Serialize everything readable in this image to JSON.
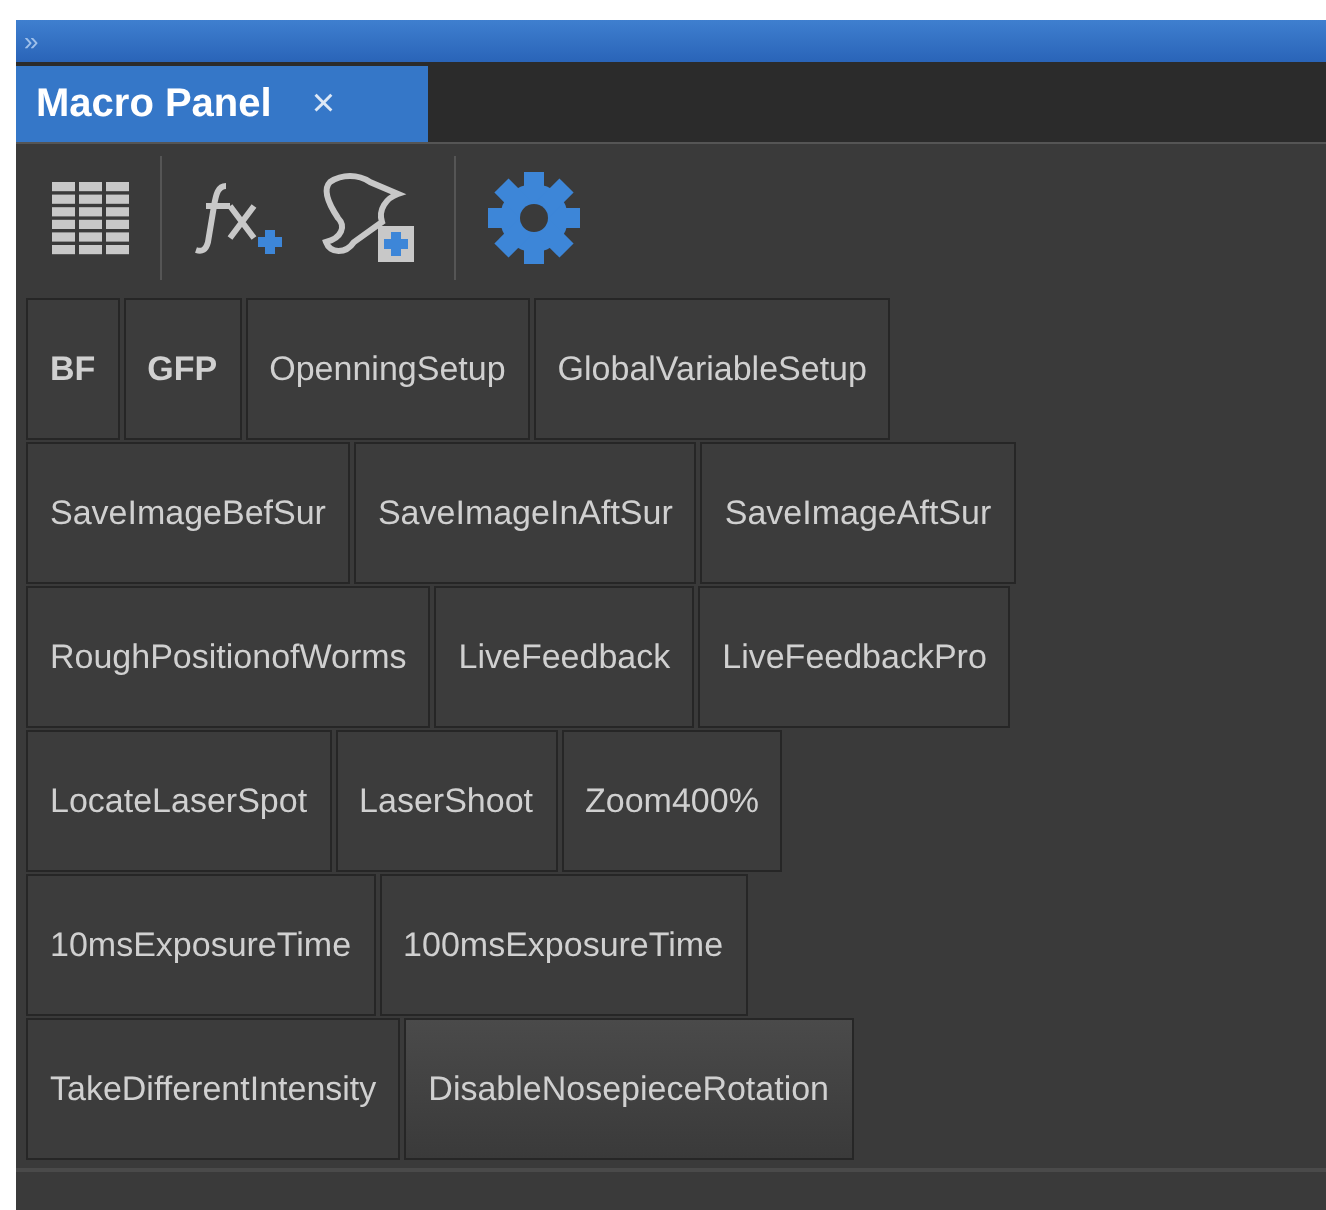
{
  "title_bar": {
    "glyph": "»"
  },
  "tab": {
    "label": "Macro Panel",
    "close": "×",
    "selected": true
  },
  "macro_rows": [
    [
      {
        "label": "BF",
        "bold": true,
        "hovered": false
      },
      {
        "label": "GFP",
        "bold": true,
        "hovered": false
      },
      {
        "label": "OpenningSetup",
        "bold": false,
        "hovered": false
      },
      {
        "label": "GlobalVariableSetup",
        "bold": false,
        "hovered": false
      }
    ],
    [
      {
        "label": "SaveImageBefSur",
        "bold": false,
        "hovered": false
      },
      {
        "label": "SaveImageInAftSur",
        "bold": false,
        "hovered": false
      },
      {
        "label": "SaveImageAftSur",
        "bold": false,
        "hovered": false
      }
    ],
    [
      {
        "label": "RoughPositionofWorms",
        "bold": false,
        "hovered": false
      },
      {
        "label": "LiveFeedback",
        "bold": false,
        "hovered": false
      },
      {
        "label": "LiveFeedbackPro",
        "bold": false,
        "hovered": false
      }
    ],
    [
      {
        "label": "LocateLaserSpot",
        "bold": false,
        "hovered": false
      },
      {
        "label": "LaserShoot",
        "bold": false,
        "hovered": false
      },
      {
        "label": "Zoom400%",
        "bold": false,
        "hovered": false
      }
    ],
    [
      {
        "label": "10msExposureTime",
        "bold": false,
        "hovered": false
      },
      {
        "label": "100msExposureTime",
        "bold": false,
        "hovered": false
      }
    ],
    [
      {
        "label": "TakeDifferentIntensity",
        "bold": false,
        "hovered": false
      },
      {
        "label": "DisableNosepieceRotation",
        "bold": false,
        "hovered": true
      }
    ]
  ]
}
